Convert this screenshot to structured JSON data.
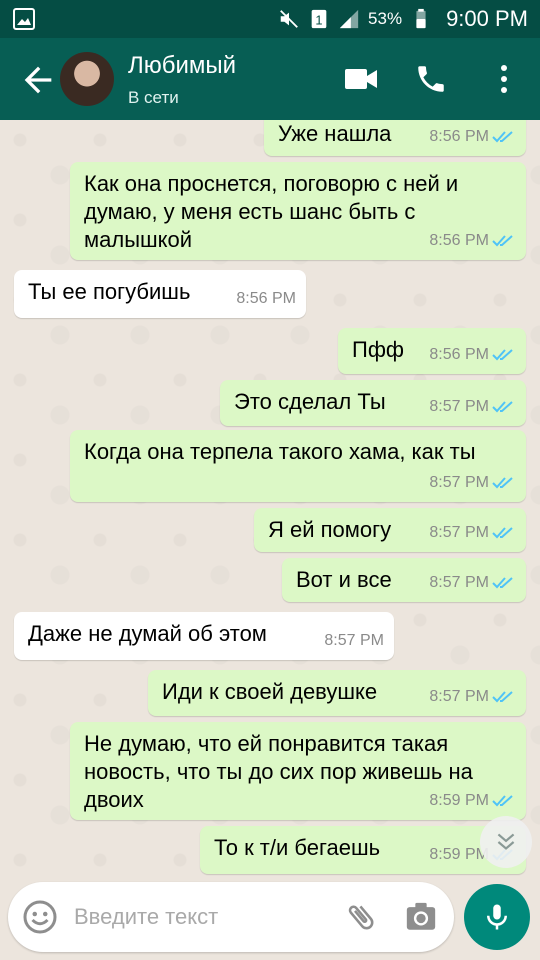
{
  "status_bar": {
    "battery": "53%",
    "time": "9:00 PM",
    "sim": "1"
  },
  "header": {
    "name": "Любимый",
    "status": "В сети"
  },
  "messages": [
    {
      "dir": "out",
      "text": "Уже нашла",
      "time": "8:56 PM"
    },
    {
      "dir": "out",
      "text": "Как она проснется, поговорю с ней и думаю, у меня есть шанс быть с малышкой",
      "time": "8:56 PM"
    },
    {
      "dir": "in",
      "text": "Ты ее погубишь",
      "time": "8:56 PM"
    },
    {
      "dir": "out",
      "text": "Пфф",
      "time": "8:56 PM"
    },
    {
      "dir": "out",
      "text": "Это сделал Ты",
      "time": "8:57 PM"
    },
    {
      "dir": "out",
      "text": "Когда она терпела такого хама, как ты",
      "time": "8:57 PM"
    },
    {
      "dir": "out",
      "text": "Я ей помогу",
      "time": "8:57 PM"
    },
    {
      "dir": "out",
      "text": "Вот и все",
      "time": "8:57 PM"
    },
    {
      "dir": "in",
      "text": "Даже не думай об этом",
      "time": "8:57 PM"
    },
    {
      "dir": "out",
      "text": "Иди к своей девушке",
      "time": "8:57 PM"
    },
    {
      "dir": "out",
      "text": "Не думаю, что ей понравится такая новость, что ты до сих пор живешь на двоих",
      "time": "8:59 PM"
    },
    {
      "dir": "out",
      "text": "То к т/и бегаешь",
      "time": "8:59 PM"
    }
  ],
  "input": {
    "placeholder": "Введите текст"
  },
  "colors": {
    "header": "#075e54",
    "status_bar": "#054d44",
    "outgoing": "#dcf8c6",
    "incoming": "#ffffff",
    "tick_read": "#4fc3f7",
    "fab": "#00897b"
  },
  "icons": [
    "image-icon",
    "mute-icon",
    "sim-icon",
    "signal-icon",
    "battery-icon",
    "back-arrow-icon",
    "video-call-icon",
    "phone-icon",
    "more-vert-icon",
    "emoji-icon",
    "attach-icon",
    "camera-icon",
    "mic-icon",
    "chevron-double-down-icon"
  ]
}
